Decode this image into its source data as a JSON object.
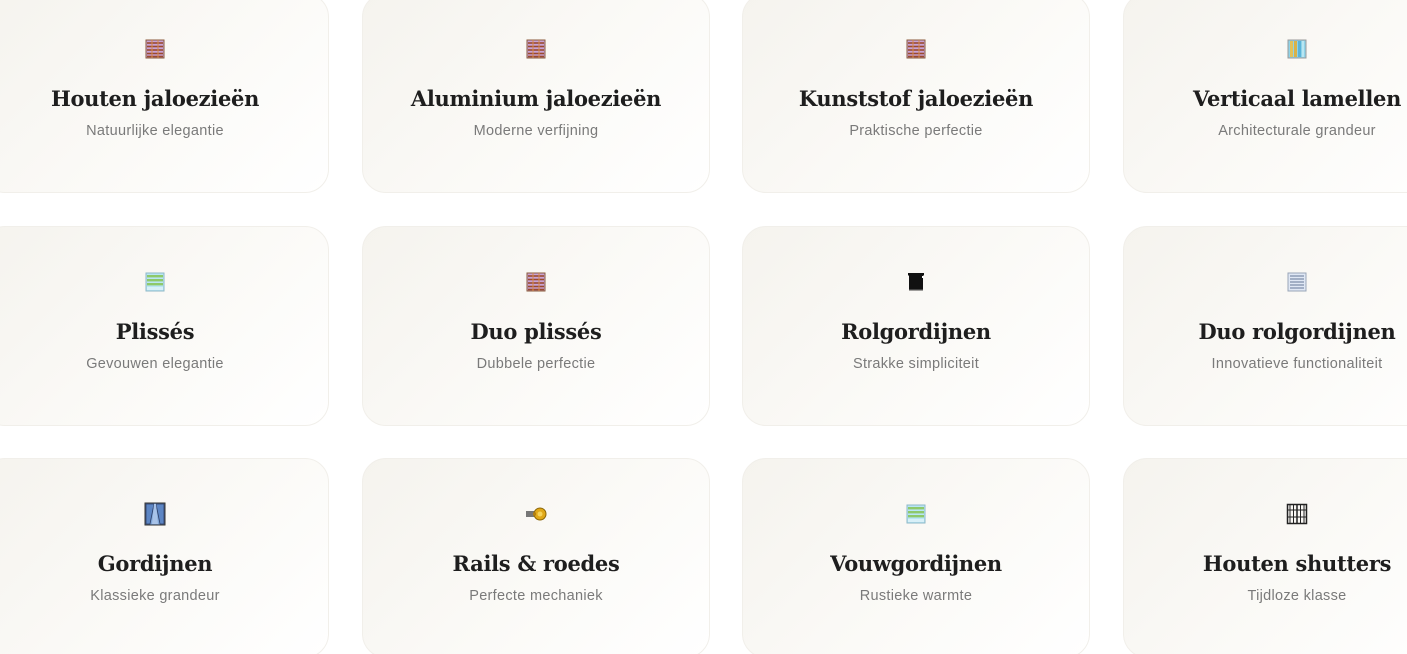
{
  "products": [
    {
      "title": "Houten jaloezieën",
      "subtitle": "Natuurlijke elegantie",
      "icon": "venetian-blind-icon"
    },
    {
      "title": "Aluminium jaloezieën",
      "subtitle": "Moderne verfijning",
      "icon": "venetian-blind-icon"
    },
    {
      "title": "Kunststof jaloezieën",
      "subtitle": "Praktische perfectie",
      "icon": "venetian-blind-icon"
    },
    {
      "title": "Verticaal lamellen",
      "subtitle": "Architecturale grandeur",
      "icon": "vertical-blind-icon"
    },
    {
      "title": "Plissés",
      "subtitle": "Gevouwen elegantie",
      "icon": "pleated-blind-icon"
    },
    {
      "title": "Duo plissés",
      "subtitle": "Dubbele perfectie",
      "icon": "venetian-blind-icon"
    },
    {
      "title": "Rolgordijnen",
      "subtitle": "Strakke simpliciteit",
      "icon": "roller-blind-icon"
    },
    {
      "title": "Duo rolgordijnen",
      "subtitle": "Innovatieve functionaliteit",
      "icon": "duo-roller-blind-icon"
    },
    {
      "title": "Gordijnen",
      "subtitle": "Klassieke grandeur",
      "icon": "curtain-icon"
    },
    {
      "title": "Rails & roedes",
      "subtitle": "Perfecte mechaniek",
      "icon": "curtain-rod-icon"
    },
    {
      "title": "Vouwgordijnen",
      "subtitle": "Rustieke warmte",
      "icon": "roman-blind-icon"
    },
    {
      "title": "Houten shutters",
      "subtitle": "Tijdloze klasse",
      "icon": "shutter-icon"
    }
  ],
  "colors": {
    "title": "#1e1e1e",
    "subtitle": "#7a7a7a",
    "card_background": "#f7f5f0"
  }
}
